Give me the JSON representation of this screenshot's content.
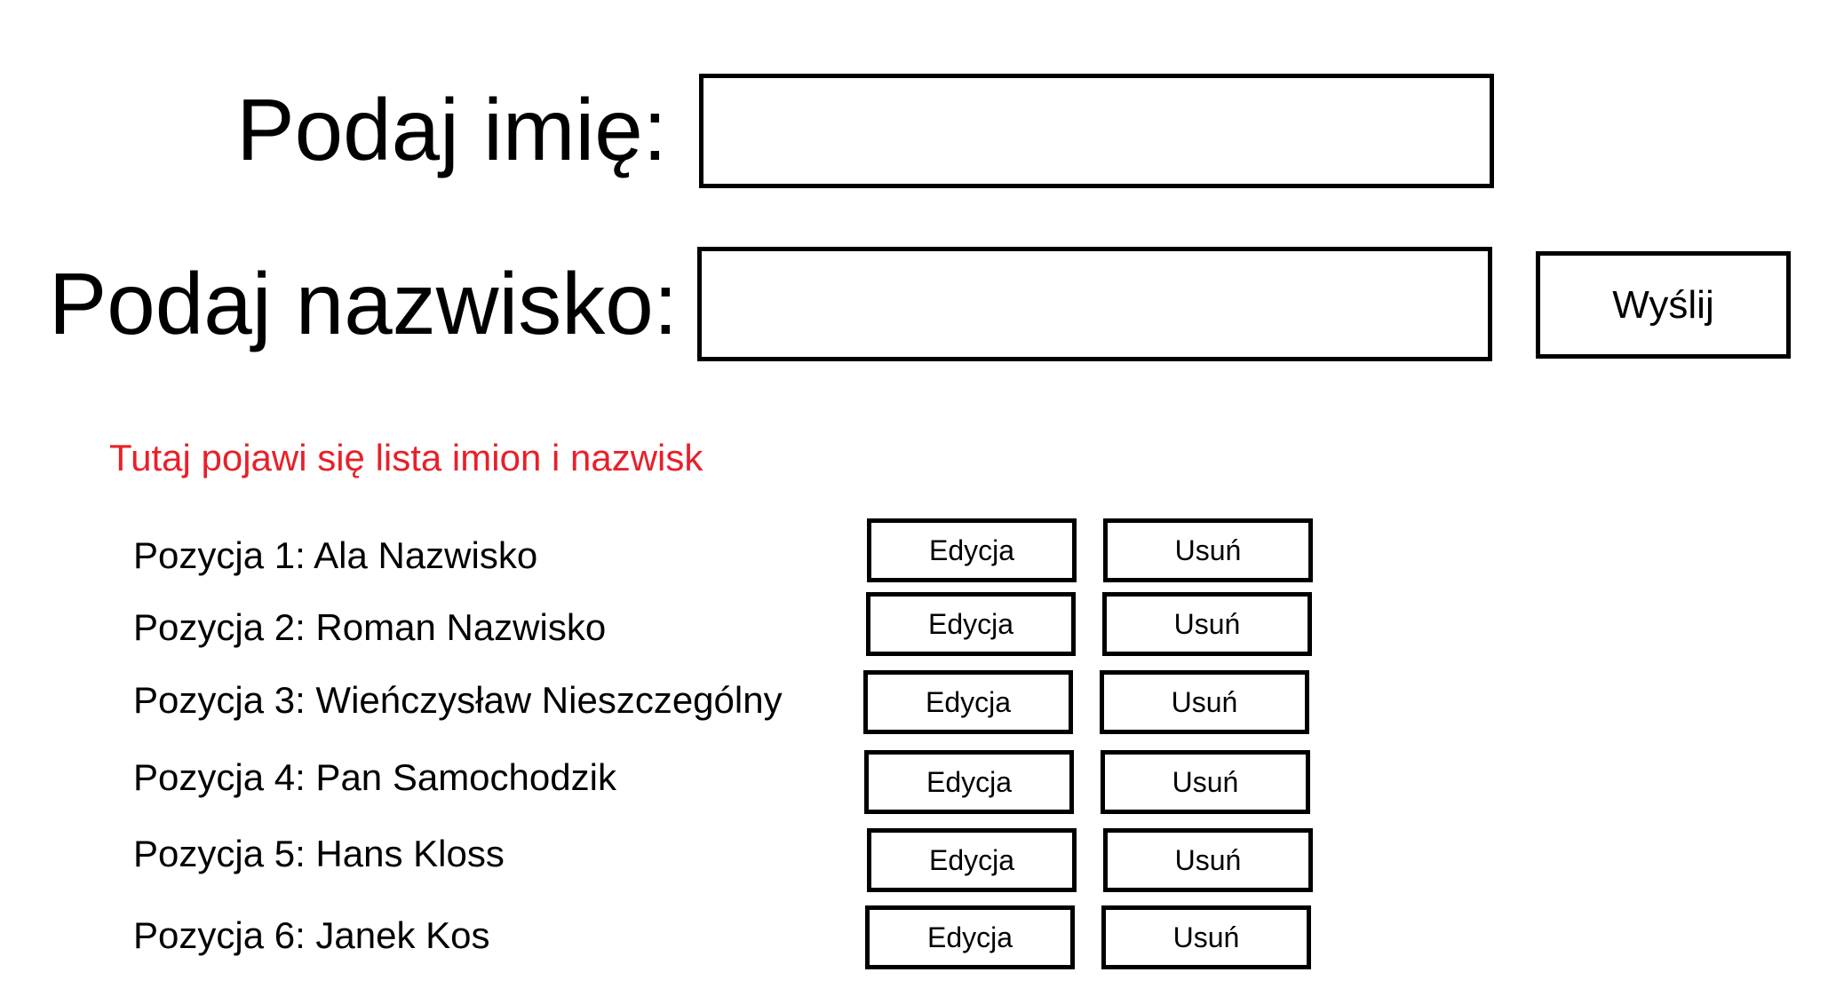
{
  "form": {
    "first_name_label": "Podaj imię:",
    "first_name_value": "",
    "last_name_label": "Podaj nazwisko:",
    "last_name_value": "",
    "submit_label": "Wyślij"
  },
  "list": {
    "heading": "Tutaj pojawi się lista imion i nazwisk",
    "heading_color": "#e8202a",
    "edit_label": "Edycja",
    "delete_label": "Usuń",
    "items": [
      {
        "label": "Pozycja 1: Ala Nazwisko"
      },
      {
        "label": "Pozycja 2: Roman Nazwisko"
      },
      {
        "label": "Pozycja 3: Wieńczysław Nieszczególny"
      },
      {
        "label": "Pozycja 4: Pan Samochodzik"
      },
      {
        "label": "Pozycja 5: Hans Kloss"
      },
      {
        "label": "Pozycja 6: Janek Kos"
      }
    ]
  }
}
